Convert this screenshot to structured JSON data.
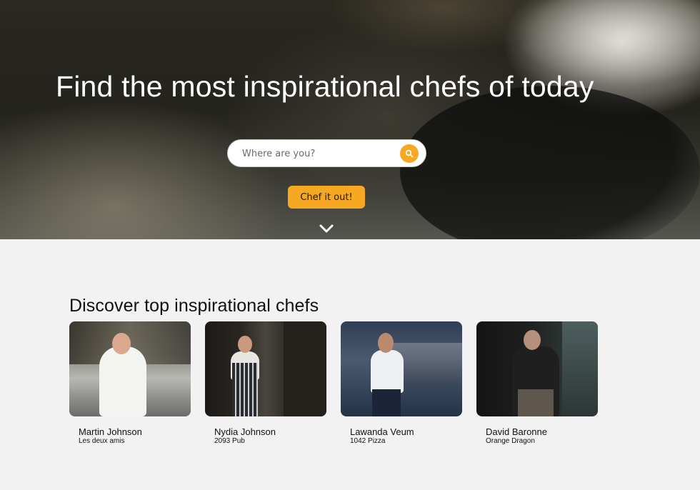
{
  "hero": {
    "title": "Find the most inspirational chefs of today",
    "search_placeholder": "Where are you?",
    "search_icon": "search-icon",
    "cta_label": "Chef it out!",
    "scroll_icon": "chevron-down-icon"
  },
  "discover": {
    "title": "Discover top inspirational chefs",
    "chefs": [
      {
        "name": "Martin Johnson",
        "place": "Les deux amis"
      },
      {
        "name": "Nydia Johnson",
        "place": "2093 Pub"
      },
      {
        "name": "Lawanda Veum",
        "place": "1042 Pizza"
      },
      {
        "name": "David Baronne",
        "place": "Orange Dragon"
      }
    ]
  },
  "colors": {
    "accent": "#f7a823",
    "page_background": "#f2f2f2"
  }
}
